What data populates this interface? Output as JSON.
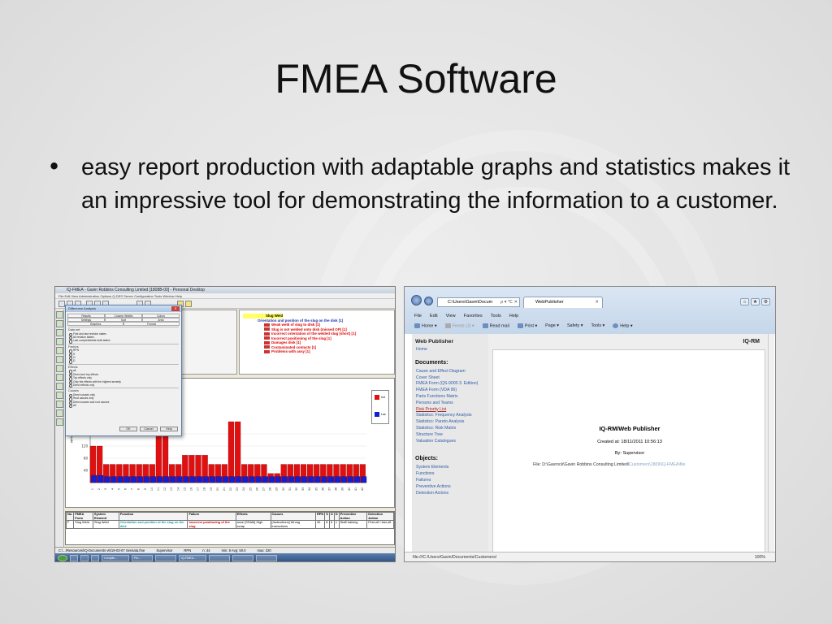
{
  "slide": {
    "title": "FMEA Software",
    "bullet_char": "•",
    "bullet_text": "easy report production with adaptable graphs and statistics makes it an impressive tool for demonstrating the information to a customer."
  },
  "left_app": {
    "title": "IQ-FMEA - Gavin Robbins Consulting Limited [1808B-00] - Personal Desktop",
    "menu": "File   Edit   View   Administration   Options   Q-DES Server   Configuration   Tools   Window   Help",
    "tree": {
      "root": "Slug Weld",
      "function": "Orientation and position of the slug on the disk [1]",
      "failures": [
        "Weak weld of slug to disk [1]",
        "Slug is not welded onto disk (missed OP) [1]",
        "Incorrect orientation of the welded slug (short) [1]",
        "Incorrect positioning of the slug [1]",
        "Damages disk [1]",
        "Contaminated contacts [1]",
        "Problems with assy [1]"
      ]
    },
    "dialog": {
      "title": "Difference Analysis",
      "close": "✕",
      "tabs": [
        "Results",
        "Column Widths",
        "Colors",
        "Settings",
        "Sort",
        "Area",
        "Graphics",
        "Format"
      ],
      "data_set_label": "Data set",
      "data_set_options": [
        "First and last revision states",
        "All revision states",
        "Last completed/last draft states"
      ],
      "factors_label": "Factors",
      "factors_options": [
        "RPN",
        "S",
        "O",
        "D"
      ],
      "effects_label": "Effects",
      "effects_options": [
        "all",
        "Direct and top effects",
        "Top effects only",
        "Only the effects with the highest severity",
        "Direct effects only"
      ],
      "causes_label": "Causes",
      "causes_options": [
        "Direct causes only",
        "Root causes only",
        "Direct causes and root causes",
        "All"
      ],
      "ok": "OK",
      "cancel": "Cancel",
      "help": "Help"
    },
    "legend": [
      "Ind",
      "Las"
    ],
    "y_title": "RPN",
    "grid": {
      "headers": [
        "No.",
        "FMEA Form",
        "System Element",
        "Function",
        "Failure",
        "Effects",
        "Causes",
        "RPN",
        "S",
        "O",
        "D",
        "Preventive Action",
        "Detection Action"
      ],
      "row": [
        "F",
        "Slug Weld",
        "Slug Weld",
        "Orientation and position of the slug on the disk",
        "Incorrect positioning of the slug",
        "ance [SSAM] High scrap",
        "[Instructions] Wrong instructions",
        "40",
        "8",
        "5",
        "1",
        "Staff training",
        "First-off / last-off"
      ]
    },
    "status": [
      "C:\\...\\Resources\\IQ-Documents v6\\19-03-07 Sensata.fme",
      "Supervisor",
      "RPN",
      "n: 44",
      "min: 8  Avg: 50.0",
      "max: 320"
    ],
    "taskbar": [
      "",
      "",
      "",
      "",
      "Compile...",
      "Fin...",
      "",
      "IQ-FMEA...",
      "",
      "",
      ""
    ]
  },
  "chart_data": {
    "type": "bar",
    "xlabel": "",
    "ylabel": "RPN",
    "ylim": [
      0,
      320
    ],
    "yticks": [
      40,
      80,
      120,
      160
    ],
    "series": [
      {
        "name": "Ind",
        "color": "#e01010",
        "values": [
          120,
          120,
          60,
          60,
          60,
          60,
          60,
          60,
          60,
          60,
          240,
          240,
          60,
          60,
          90,
          90,
          90,
          90,
          60,
          60,
          60,
          200,
          200,
          60,
          60,
          60,
          60,
          30,
          30,
          60,
          60,
          60,
          60,
          60,
          60,
          60,
          60,
          60,
          60,
          60,
          60,
          60
        ]
      },
      {
        "name": "Las",
        "color": "#1020d0",
        "values": [
          24,
          24,
          20,
          20,
          20,
          20,
          20,
          20,
          20,
          20,
          20,
          20,
          20,
          20,
          20,
          20,
          20,
          20,
          20,
          20,
          20,
          20,
          20,
          20,
          20,
          20,
          20,
          20,
          20,
          20,
          20,
          20,
          20,
          20,
          20,
          20,
          20,
          20,
          20,
          20,
          20,
          20
        ]
      }
    ]
  },
  "right_app": {
    "address": "C:\\Users\\Gavin\\Docum",
    "address_ctl": "ρ ▾ ℃ ✕",
    "tab_title": "WebPublisher",
    "tab_close": "✕",
    "menu": [
      "File",
      "Edit",
      "View",
      "Favorites",
      "Tools",
      "Help"
    ],
    "toolbar": [
      "Home ▾",
      "Feeds (J) ▾",
      "Read mail",
      "Print ▾",
      "Page ▾",
      "Safety ▾",
      "Tools ▾",
      "Help ▾"
    ],
    "sidebar_title": "Web Publisher",
    "home": "Home",
    "documents_title": "Documents:",
    "documents": [
      "Cause and Effect Diagram",
      "Cover Sheet",
      "FMEA Form (QS-9000 3. Edition)",
      "FMEA Form (VDA 96)",
      "Parts Functions Matrix",
      "Persons and Teams",
      "Risk Priority List",
      "Statistics: Frequency Analysis",
      "Statistics: Pareto Analysis",
      "Statistics: Risk Matrix",
      "Structure Tree",
      "Valuation Catalogues"
    ],
    "objects_title": "Objects:",
    "objects": [
      "System Elements",
      "Functions",
      "Failures",
      "Preventive Actions",
      "Detection Actions"
    ],
    "header_right": "IQ-RM",
    "doc_title": "IQ-RM/Web Publisher",
    "created": "Created at: 18/11/2011 10:56:13",
    "by": "By: Supervisor",
    "file_label": "File: D:\\Gavrock\\Gavin Robbins Consulting Limited\\",
    "file_rest": "Customers\\1809\\IQ-FMEA\\file",
    "status": "file:///C:/Users/Gavin/Documents/Customers/",
    "zoom": "100%"
  }
}
